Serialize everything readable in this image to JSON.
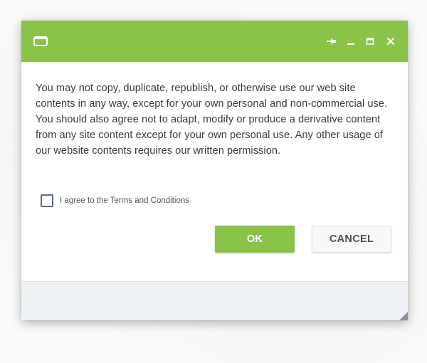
{
  "window": {
    "accent_color": "#8bc34a",
    "icon": "window-icon",
    "controls": {
      "pin_icon": "pin-icon",
      "minimize_icon": "minimize-icon",
      "maximize_icon": "maximize-icon",
      "close_icon": "close-icon"
    }
  },
  "dialog": {
    "message": "You may not copy, duplicate, republish, or otherwise use our web site contents in any way, except for your own personal and non-commercial use. You should also agree not to adapt, modify or produce a derivative content from any site content except for your own personal use. Any other usage of our website contents requires our written permission.",
    "checkbox_label": "I agree to the Terms and Conditions",
    "checkbox_checked": false,
    "ok_label": "OK",
    "cancel_label": "CANCEL"
  }
}
